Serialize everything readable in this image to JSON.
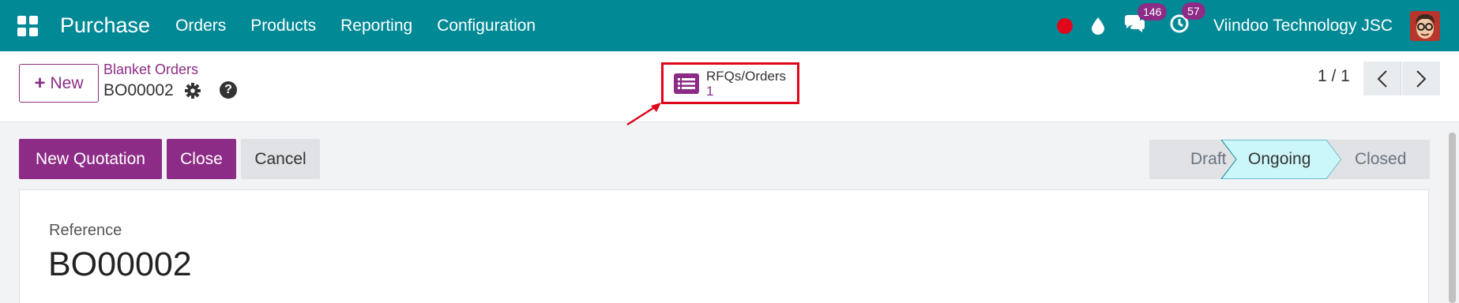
{
  "navbar": {
    "app_name": "Purchase",
    "menu": [
      "Orders",
      "Products",
      "Reporting",
      "Configuration"
    ],
    "messages_count": "146",
    "activities_count": "57",
    "company": "Viindoo Technology JSC"
  },
  "control_panel": {
    "new_label": "New",
    "breadcrumb_parent": "Blanket Orders",
    "breadcrumb_current": "BO00002",
    "smart_button": {
      "label": "RFQs/Orders",
      "value": "1"
    },
    "pager": "1 / 1"
  },
  "actions": {
    "new_quotation": "New Quotation",
    "close": "Close",
    "cancel": "Cancel"
  },
  "statusbar": {
    "stages": [
      "Draft",
      "Ongoing",
      "Closed"
    ],
    "current": "Ongoing"
  },
  "form": {
    "reference_label": "Reference",
    "reference_value": "BO00002"
  },
  "colors": {
    "navbar": "#018a96",
    "brand": "#8c2c86",
    "highlight": "#e0061b",
    "stage_active": "#ccf7fa"
  }
}
